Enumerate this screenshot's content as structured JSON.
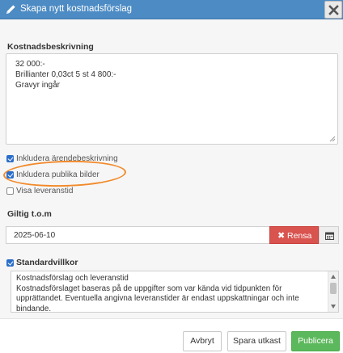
{
  "dialog": {
    "title": "Skapa nytt kostnadsförslag",
    "close_icon": "close-icon"
  },
  "description": {
    "label": "Kostnadsbeskrivning",
    "lines": [
      "32 000:-",
      "Brillianter 0,03ct 5 st 4 800:-",
      "Gravyr ingår"
    ]
  },
  "options": {
    "include_case_description": {
      "label": "Inkludera ärendebeskrivning",
      "checked": true
    },
    "include_public_images": {
      "label": "Inkludera publika bilder",
      "checked": true
    },
    "show_delivery_time": {
      "label": "Visa leveranstid",
      "checked": false
    }
  },
  "annotation": {
    "color": "#f28a2b"
  },
  "valid_until": {
    "label": "Giltig t.o.m",
    "value": "2025-06-10",
    "clear_label": "Rensa",
    "calendar_icon": "calendar-icon"
  },
  "standard_terms": {
    "label": "Standardvillkor",
    "checked": true,
    "lines": [
      "Kostnadsförslag och leveranstid",
      "Kostnadsförslaget baseras på de uppgifter som var kända vid tidpunkten för",
      "upprättandet. Eventuella angivna leveranstider är endast uppskattningar och inte",
      "bindande."
    ]
  },
  "footer": {
    "cancel_label": "Avbryt",
    "save_draft_label": "Spara utkast",
    "publish_label": "Publicera"
  },
  "colors": {
    "header": "#4c8bc4",
    "danger": "#d9534f",
    "success": "#5cb85c",
    "checkbox": "#2b6ec9"
  }
}
